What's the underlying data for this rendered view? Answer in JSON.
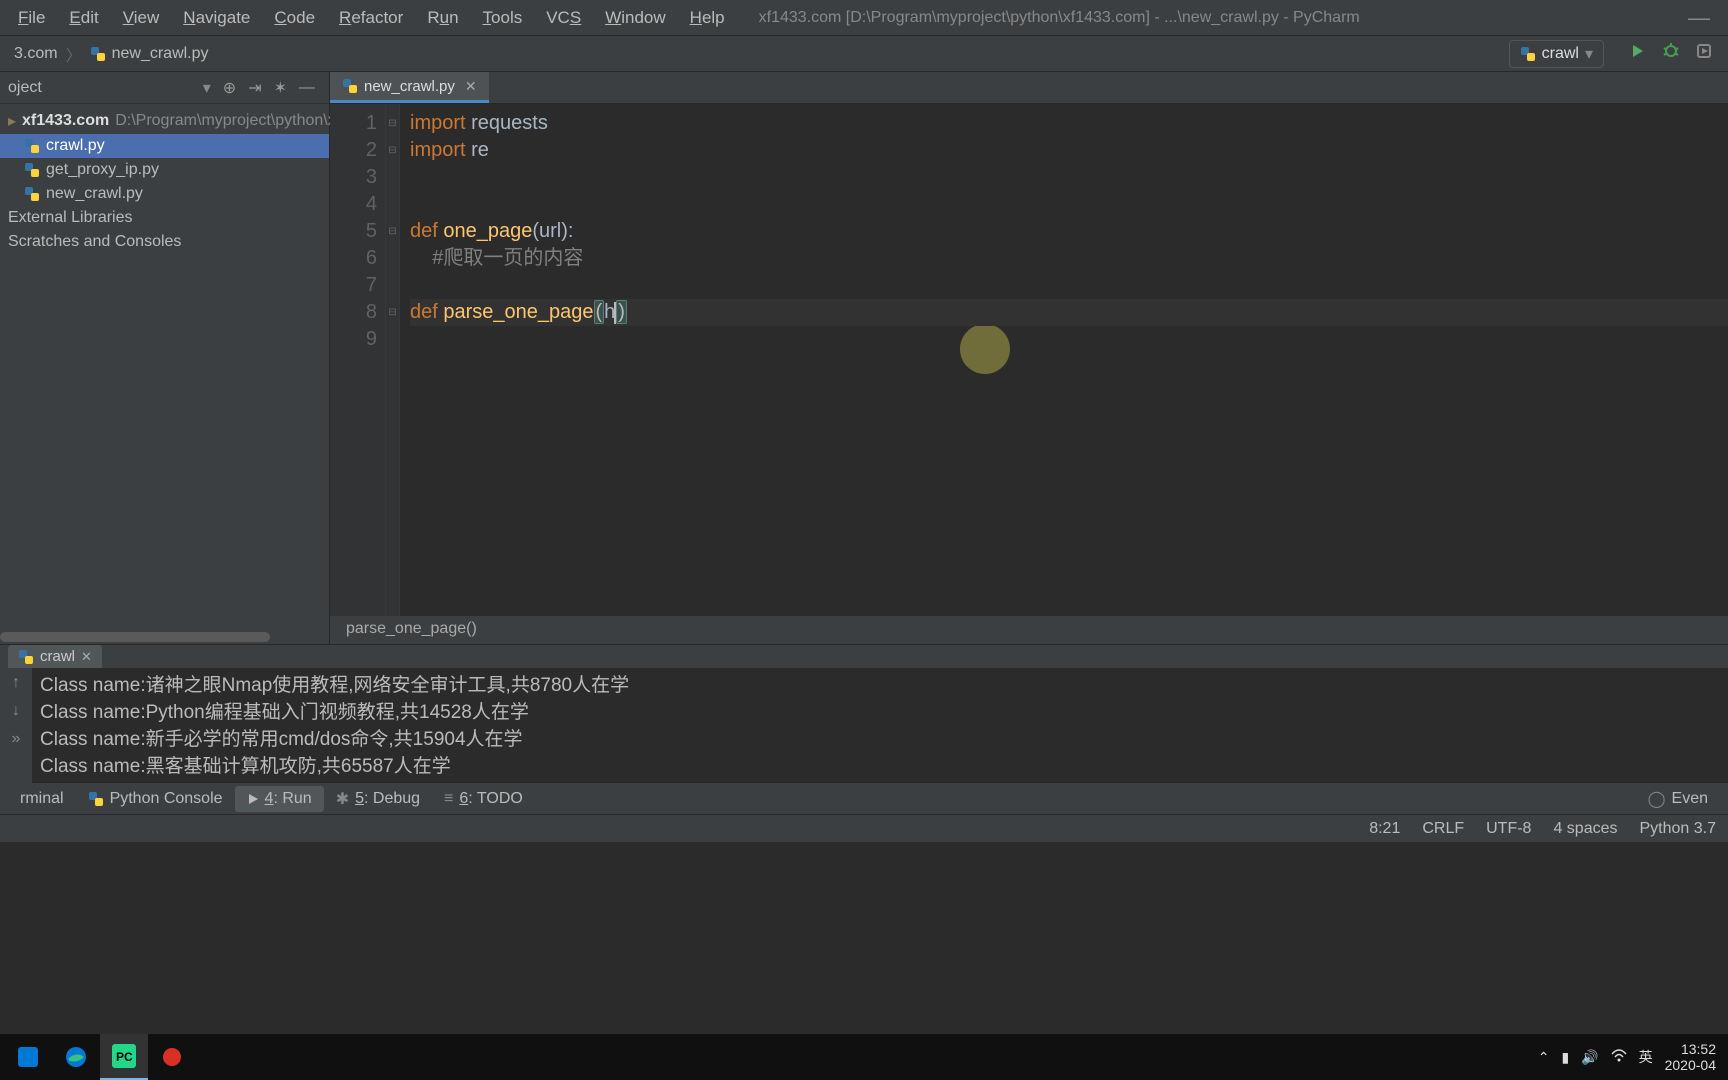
{
  "menubar": {
    "items": [
      {
        "label": "File",
        "u": 0
      },
      {
        "label": "Edit",
        "u": 0
      },
      {
        "label": "View",
        "u": 0
      },
      {
        "label": "Navigate",
        "u": 0
      },
      {
        "label": "Code",
        "u": 0
      },
      {
        "label": "Refactor",
        "u": 0
      },
      {
        "label": "Run",
        "u": 1
      },
      {
        "label": "Tools",
        "u": 0
      },
      {
        "label": "VCS",
        "u": 2
      },
      {
        "label": "Window",
        "u": 0
      },
      {
        "label": "Help",
        "u": 0
      }
    ],
    "title": "xf1433.com [D:\\Program\\myproject\\python\\xf1433.com] - ...\\new_crawl.py - PyCharm"
  },
  "breadcrumb": {
    "parts": [
      "3.com",
      "new_crawl.py"
    ]
  },
  "run_config": "crawl",
  "sidebar": {
    "title": "oject",
    "root": {
      "name": "xf1433.com",
      "path": "D:\\Program\\myproject\\python\\xf"
    },
    "files": [
      "crawl.py",
      "get_proxy_ip.py",
      "new_crawl.py"
    ],
    "external": "External Libraries",
    "scratches": "Scratches and Consoles",
    "selected_index": 0
  },
  "tab": {
    "label": "new_crawl.py"
  },
  "code_lines": [
    {
      "n": 1,
      "tokens": [
        {
          "t": "kw",
          "v": "import "
        },
        {
          "t": "txt",
          "v": "requests"
        }
      ]
    },
    {
      "n": 2,
      "tokens": [
        {
          "t": "kw",
          "v": "import "
        },
        {
          "t": "txt",
          "v": "re"
        }
      ]
    },
    {
      "n": 3,
      "tokens": []
    },
    {
      "n": 4,
      "tokens": []
    },
    {
      "n": 5,
      "tokens": [
        {
          "t": "kw",
          "v": "def "
        },
        {
          "t": "fn",
          "v": "one_page"
        },
        {
          "t": "txt",
          "v": "("
        },
        {
          "t": "par",
          "v": "url"
        },
        {
          "t": "txt",
          "v": "):"
        }
      ]
    },
    {
      "n": 6,
      "tokens": [
        {
          "t": "txt",
          "v": "    "
        },
        {
          "t": "cmt",
          "v": "#爬取一页的内容"
        }
      ]
    },
    {
      "n": 7,
      "tokens": []
    },
    {
      "n": 8,
      "caret": true,
      "tokens": [
        {
          "t": "kw",
          "v": "def "
        },
        {
          "t": "fn",
          "v": "parse_one_page"
        },
        {
          "t": "bracket",
          "v": "("
        },
        {
          "t": "par",
          "v": "h"
        },
        {
          "t": "caret",
          "v": ""
        },
        {
          "t": "bracket",
          "v": ")"
        },
        {
          "t": "err",
          "v": "  "
        }
      ]
    },
    {
      "n": 9,
      "tokens": [
        {
          "t": "txt",
          "v": "    "
        },
        {
          "t": "err",
          "v": "  "
        }
      ]
    }
  ],
  "editor_crumb": "parse_one_page()",
  "run": {
    "tab": "crawl",
    "output": [
      "Class name:诸神之眼Nmap使用教程,网络安全审计工具,共8780人在学",
      "Class name:Python编程基础入门视频教程,共14528人在学",
      "Class name:新手必学的常用cmd/dos命令,共15904人在学",
      "Class name:黑客基础计算机攻防,共65587人在学"
    ]
  },
  "bottom_tabs": {
    "items": [
      "rminal",
      "Python Console",
      "4: Run",
      "5: Debug",
      "6: TODO"
    ],
    "active": 2,
    "right": "Even"
  },
  "status": {
    "pos": "8:21",
    "sep": "CRLF",
    "enc": "UTF-8",
    "indent": "4 spaces",
    "python": "Python 3.7"
  },
  "tray": {
    "ime": "英",
    "time": "13:52",
    "date": "2020-04"
  }
}
